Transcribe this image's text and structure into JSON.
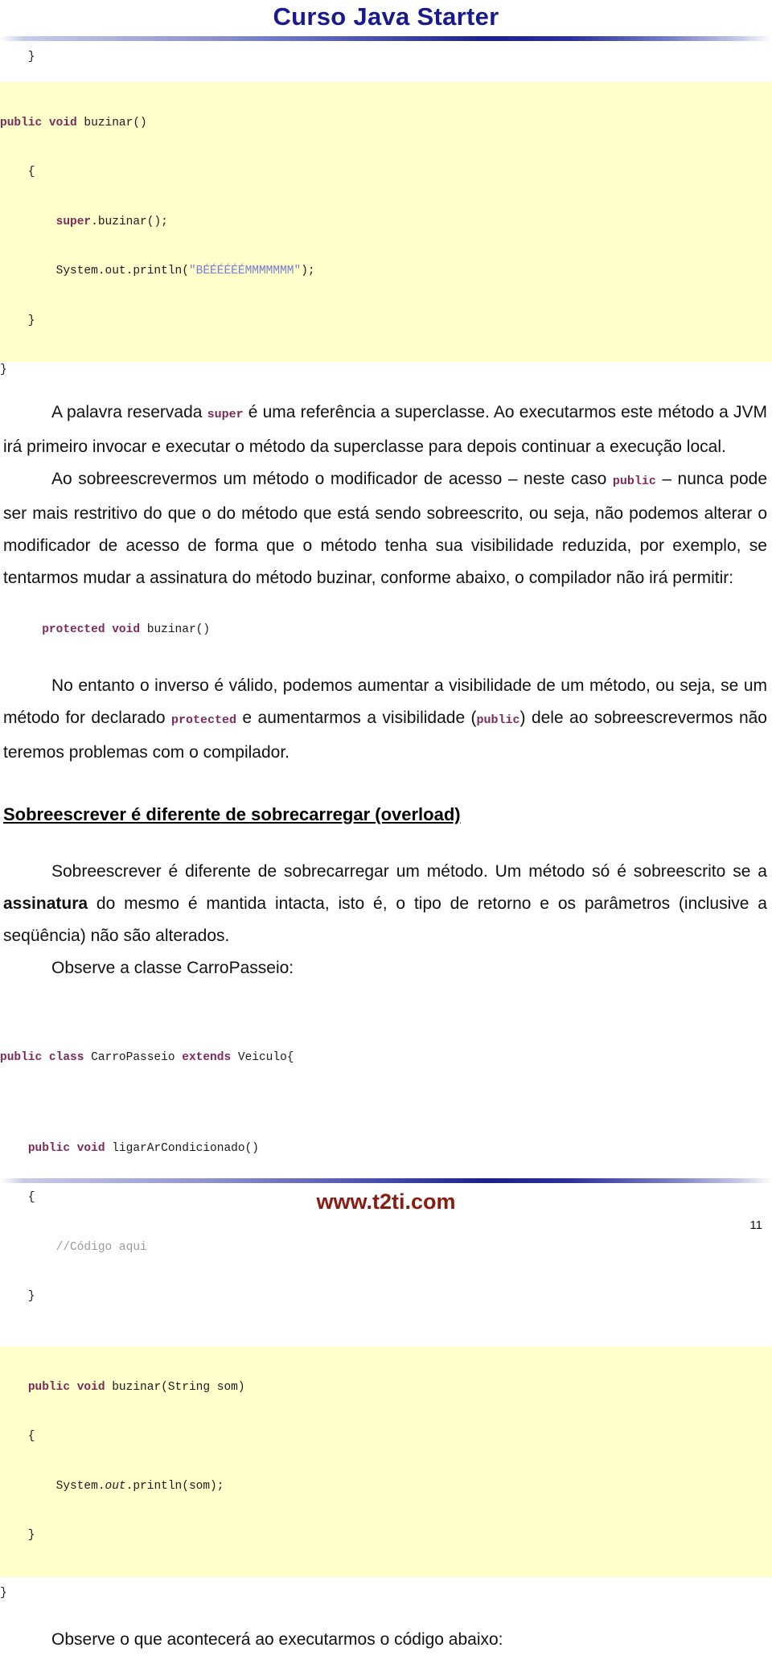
{
  "header": {
    "title": "Curso Java Starter"
  },
  "code_block_top": {
    "pre_line": "    }",
    "highlighted_lines": [
      {
        "indent": "    ",
        "keywords": "public void",
        "rest": " buzinar()"
      },
      {
        "indent": "    ",
        "keywords": "",
        "rest": "{"
      },
      {
        "indent": "        ",
        "keywords": "super",
        "rest": ".buzinar();"
      },
      {
        "indent": "        ",
        "keywords": "",
        "rest": "System.out.println(\"BÉÉÉÉÉÉMMMMMMM\");"
      },
      {
        "indent": "    ",
        "keywords": "",
        "rest": "}"
      }
    ],
    "line_1": "    }",
    "line_2_kw": "public void",
    "line_2_rest": " buzinar()",
    "line_3": "    {",
    "line_4_kw": "super",
    "line_4_rest": ".buzinar();",
    "line_5_pre": "        System.out.println(",
    "line_5_str": "\"BÉÉÉÉÉÉMMMMMMM\"",
    "line_5_post": ");",
    "line_6": "    }",
    "post_line": "}"
  },
  "paragraphs": {
    "p1_a": "A palavra reservada ",
    "p1_kw": "super",
    "p1_b": " é uma referência a superclasse. Ao executarmos este método a JVM irá primeiro invocar e executar o método da superclasse para depois continuar a execução local.",
    "p2_a": "Ao sobreescrevermos um método o modificador de acesso – neste caso ",
    "p2_kw": "public",
    "p2_b": " – nunca pode ser mais restritivo do que o do método que está sendo sobreescrito, ou seja, não podemos alterar o modificador de acesso de forma que o método tenha sua visibilidade reduzida, por exemplo, se tentarmos mudar a assinatura do método buzinar, conforme abaixo, o compilador não irá permitir:",
    "p3_a": "No entanto o inverso é válido, podemos aumentar a visibilidade de um método, ou seja, se um método for declarado  ",
    "p3_kw1": "protected",
    "p3_b": " e aumentarmos a visibilidade (",
    "p3_kw2": "public",
    "p3_c": ") dele ao sobreescrevermos não teremos problemas com o compilador.",
    "p4_a": "Sobreescrever é diferente de sobrecarregar um método. Um método só é sobreescrito se a ",
    "p4_bold": "assinatura",
    "p4_b": " do mesmo é mantida intacta, isto é, o tipo de retorno e os parâmetros (inclusive a seqüência) não são alterados.",
    "p5": "Observe a classe CarroPasseio:",
    "p6": "Observe o que acontecerá ao executarmos o código abaixo:"
  },
  "section_heading": "Sobreescrever é diferente de sobrecarregar (overload)",
  "code_signature": {
    "keywords": "protected void",
    "rest": " buzinar()"
  },
  "code_block_bottom": {
    "line_1_kw": "public class",
    "line_1_mid": " CarroPasseio ",
    "line_1_kw2": "extends",
    "line_1_rest": " Veiculo{",
    "line_2_kw": "public void",
    "line_2_rest": " ligarArCondicionado()",
    "line_3": "    {",
    "line_4_comment": "        //Código aqui",
    "line_5": "    }",
    "line_6_kw": "public void",
    "line_6_rest": " buzinar(String som)",
    "line_7": "    {",
    "line_8_pre": "        System.",
    "line_8_ital": "out",
    "line_8_post": ".println(som);",
    "line_9": "    }",
    "line_10": "}"
  },
  "footer": {
    "site": "www.t2ti.com",
    "page_number": "11"
  },
  "colors": {
    "title": "#1a1a8c",
    "keyword": "#7d2b57",
    "string": "#7a7ad0",
    "comment": "#9a9a9a",
    "code_highlight": "#ffffcc",
    "footer_site": "#8b1a10",
    "divider_dark": "#1a1f8f"
  }
}
